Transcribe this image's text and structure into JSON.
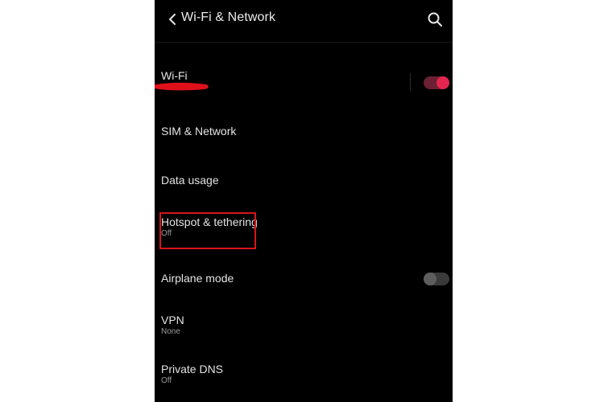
{
  "header": {
    "title": "Wi-Fi & Network",
    "back_icon": "chevron-left-icon",
    "search_icon": "search-icon"
  },
  "items": [
    {
      "title": "Wi-Fi",
      "subtitle": "",
      "toggle": "on"
    },
    {
      "title": "SIM & Network",
      "subtitle": ""
    },
    {
      "title": "Data usage",
      "subtitle": ""
    },
    {
      "title": "Hotspot & tethering",
      "subtitle": "Off"
    },
    {
      "title": "Airplane mode",
      "subtitle": "",
      "toggle": "off"
    },
    {
      "title": "VPN",
      "subtitle": "None"
    },
    {
      "title": "Private DNS",
      "subtitle": "Off"
    }
  ],
  "colors": {
    "background": "#000000",
    "accent": "#e2264f",
    "annotation": "#d9141b"
  }
}
